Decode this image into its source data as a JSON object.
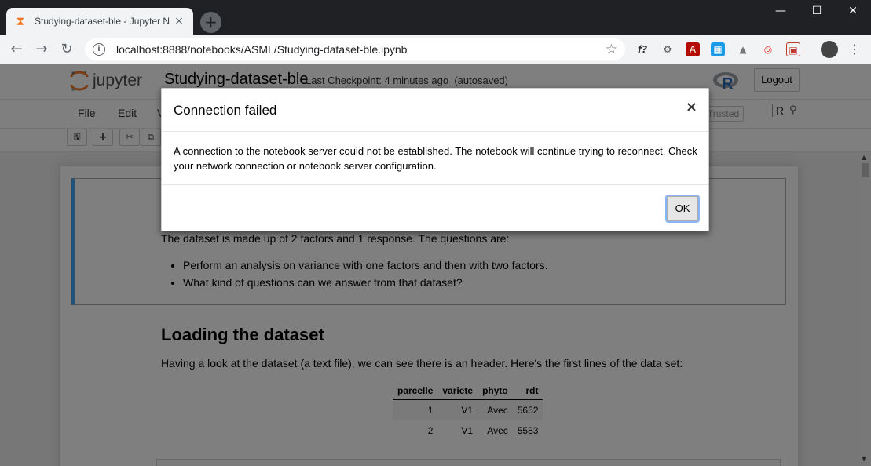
{
  "browser": {
    "tab_title": "Studying-dataset-ble - Jupyter N",
    "tab_favicon": "⧗",
    "tab_close": "×",
    "new_tab": "+",
    "window_controls": {
      "minimize": "—",
      "maximize": "☐",
      "close": "✕"
    },
    "nav": {
      "back": "←",
      "forward": "→",
      "reload": "↻"
    },
    "info_icon": "i",
    "url": "localhost:8888/notebooks/ASML/Studying-dataset-ble.ipynb",
    "star_icon": "☆",
    "extensions": [
      "f?",
      "⚙",
      "A",
      "▦",
      "▲",
      "◎",
      "▣"
    ],
    "menu_icon": "⋮"
  },
  "jupyter": {
    "logo_text": "jupyter",
    "notebook_name": "Studying-dataset-ble",
    "checkpoint": "Last Checkpoint: 4 minutes ago",
    "autosave": "(autosaved)",
    "r_logo": "R",
    "logout": "Logout",
    "menus": [
      "File",
      "Edit",
      "V"
    ],
    "trusted": "Trusted",
    "kernel": "R",
    "kernel_icon": "⚲",
    "toolbar_icons": {
      "save": "🖫",
      "add": "+",
      "cut": "✂",
      "copy": "⧉"
    }
  },
  "notebook": {
    "intro": "The dataset is made up of 2 factors and 1 response. The questions are:",
    "questions": [
      "Perform an analysis on variance with one factors and then with two factors.",
      "What kind of questions can we answer from that dataset?"
    ],
    "heading": "Loading the dataset",
    "paragraph": "Having a look at the dataset (a text file), we can see there is an header. Here's the first lines of the data set:",
    "table": {
      "columns": [
        "parcelle",
        "variete",
        "phyto",
        "rdt"
      ],
      "rows": [
        [
          "1",
          "V1",
          "Avec",
          "5652"
        ],
        [
          "2",
          "V1",
          "Avec",
          "5583"
        ]
      ]
    }
  },
  "modal": {
    "title": "Connection failed",
    "close": "×",
    "body": "A connection to the notebook server could not be established. The notebook will continue trying to reconnect. Check your network connection or notebook server configuration.",
    "ok": "OK"
  },
  "colors": {
    "chrome_dark": "#202124",
    "jupyter_orange": "#f37726",
    "cell_selected_border": "#42a5f5"
  }
}
